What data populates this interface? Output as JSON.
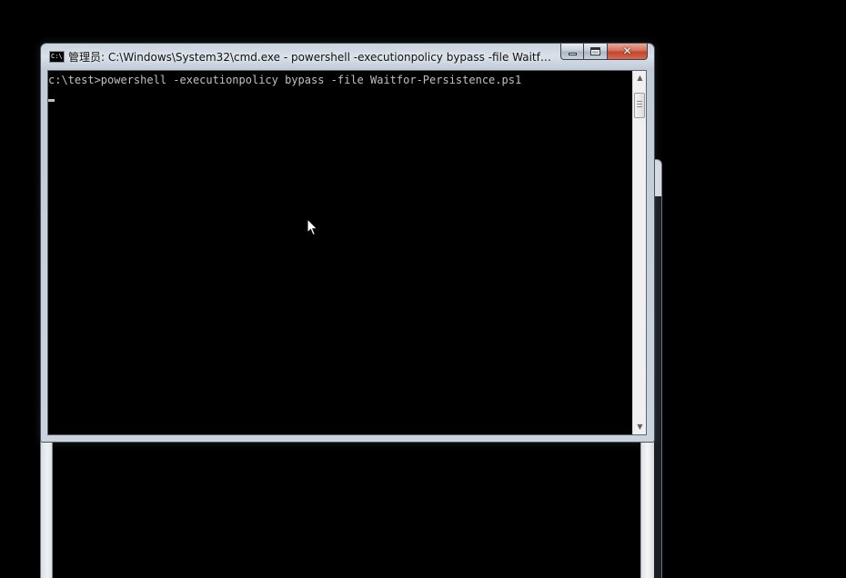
{
  "background_window": {
    "note_visible": false
  },
  "window": {
    "title": "管理员: C:\\Windows\\System32\\cmd.exe - powershell  -executionpolicy bypass -file Waitfor-...",
    "icon_label": "C:\\",
    "controls": {
      "minimize_icon": "minimize-icon",
      "maximize_icon": "maximize-icon",
      "close_glyph": "✕"
    }
  },
  "console": {
    "lines": [
      "c:\\test>powershell -executionpolicy bypass -file Waitfor-Persistence.ps1"
    ],
    "text_color": "#c0c0c0",
    "background_color": "#000000"
  },
  "scrollbar": {
    "up_arrow": "▲",
    "down_arrow": "▼"
  },
  "colors": {
    "close_button": "#c4442b",
    "window_frame": "#c9d3de"
  }
}
